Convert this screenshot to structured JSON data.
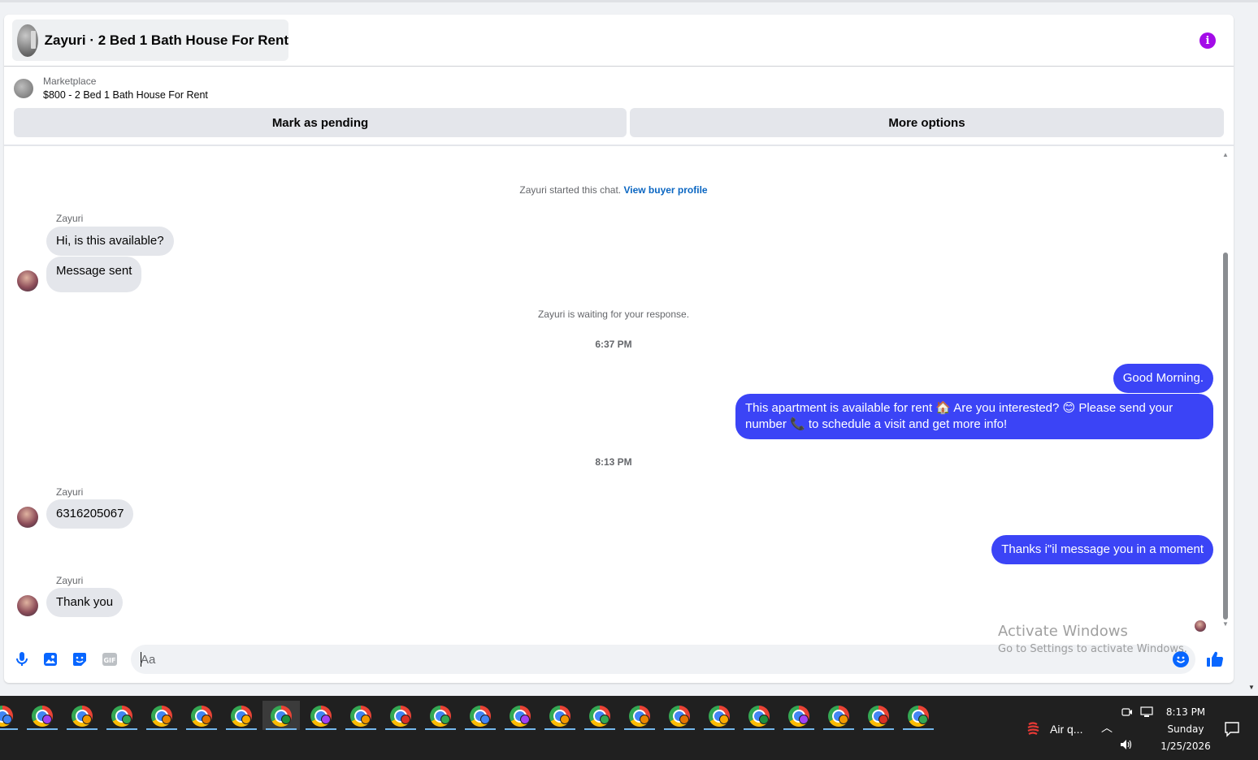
{
  "header": {
    "title": "Zayuri · 2 Bed 1 Bath House For Rent",
    "info_icon": "info-icon"
  },
  "listing": {
    "source": "Marketplace",
    "summary": "$800 - 2 Bed 1 Bath House For Rent"
  },
  "actions": {
    "mark_pending": "Mark as pending",
    "more_options": "More options"
  },
  "chat": {
    "started_text": "Zayuri started this chat.",
    "view_profile": "View buyer profile",
    "waiting_text": "Zayuri is waiting for your response.",
    "time_1": "6:37 PM",
    "time_2": "8:13 PM",
    "groups": [
      {
        "sender": "Zayuri",
        "messages": [
          "Hi, is this available?",
          "Message sent"
        ]
      },
      {
        "sender": "Zayuri",
        "messages": [
          "6316205067"
        ]
      },
      {
        "sender": "Zayuri",
        "messages": [
          "Thank you"
        ]
      }
    ],
    "outgoing": [
      "Good Morning.",
      "This apartment is available for rent 🏠 Are you interested? 😊 Please send your number 📞 to schedule a visit and get more info!",
      "Thanks i\"il message you in a moment"
    ]
  },
  "composer": {
    "placeholder": "Aa",
    "value": "",
    "icons": [
      "microphone-icon",
      "image-icon",
      "sticker-icon",
      "gif-icon",
      "emoji-icon",
      "like-icon"
    ],
    "gif_label": "GIF"
  },
  "watermark": {
    "title": "Activate Windows",
    "subtitle": "Go to Settings to activate Windows."
  },
  "taskbar": {
    "app_count": 24,
    "air_label": "Air q...",
    "clock_time": "8:13 PM",
    "clock_day": "Sunday",
    "clock_date": "1/25/2026"
  },
  "colors": {
    "outgoing_bubble": "#3b44f6",
    "incoming_bubble": "#e4e6eb",
    "accent": "#0866ff",
    "info": "#a30be8"
  }
}
